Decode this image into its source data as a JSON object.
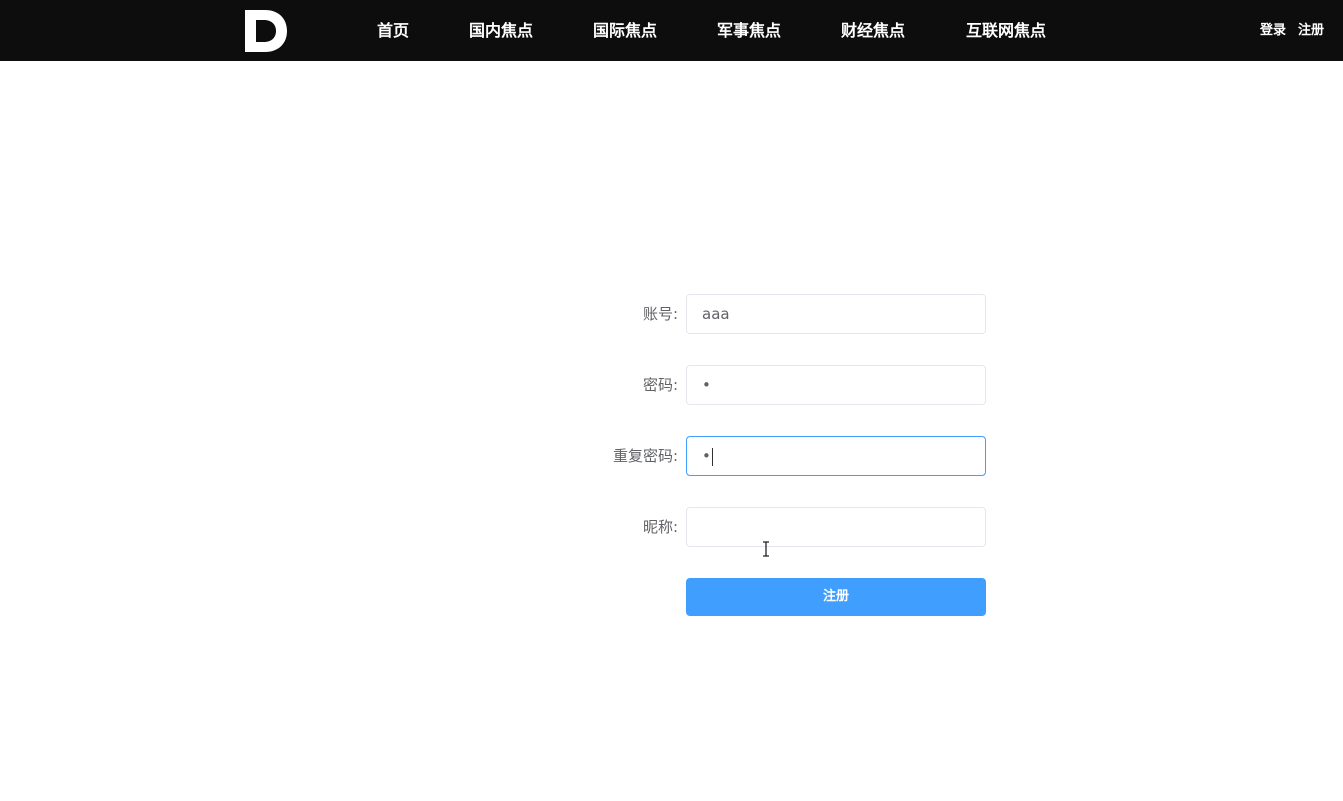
{
  "header": {
    "logo_icon": "d-logo-icon",
    "nav": [
      "首页",
      "国内焦点",
      "国际焦点",
      "军事焦点",
      "财经焦点",
      "互联网焦点"
    ],
    "login": "登录",
    "register": "注册"
  },
  "form": {
    "account": {
      "label": "账号:",
      "value": "aaa"
    },
    "password": {
      "label": "密码:",
      "value": "•"
    },
    "repeat_password": {
      "label": "重复密码:",
      "value": "•"
    },
    "nickname": {
      "label": "昵称:",
      "value": ""
    },
    "submit_label": "注册"
  },
  "colors": {
    "header_bg": "#0d0d0d",
    "primary": "#409eff",
    "label": "#606266",
    "input_border": "#e4e7ed"
  }
}
